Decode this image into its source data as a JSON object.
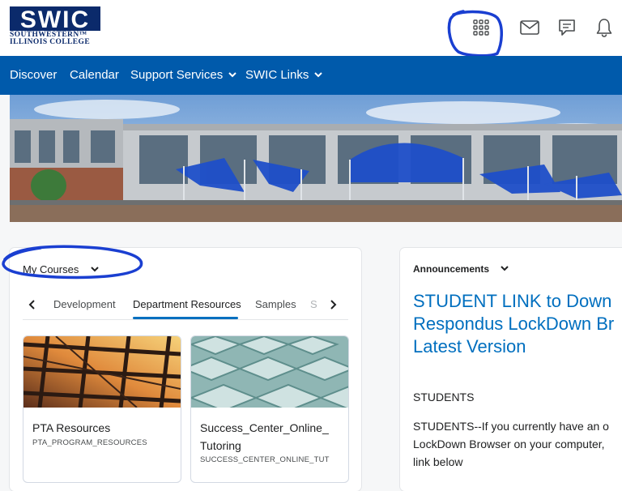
{
  "header": {
    "logo_abbrev": "SWIC",
    "logo_line1": "SOUTHWESTERN™",
    "logo_line2": "ILLINOIS COLLEGE",
    "icons": [
      "apps-grid-icon",
      "mail-icon",
      "chat-icon",
      "bell-icon"
    ]
  },
  "navbar": {
    "items": [
      {
        "label": "Discover"
      },
      {
        "label": "Calendar"
      },
      {
        "label": "Support Services"
      },
      {
        "label": "SWIC Links"
      }
    ]
  },
  "my_courses": {
    "title": "My Courses",
    "tabs": [
      {
        "label": "Development"
      },
      {
        "label": "Department Resources",
        "selected": true
      },
      {
        "label": "Samples"
      },
      {
        "label": "S"
      }
    ],
    "courses": [
      {
        "name": "PTA Resources",
        "code": "PTA_PROGRAM_RESOURCES"
      },
      {
        "name_line1": "Success_Center_Online_",
        "name_line2": "Tutoring",
        "code": "SUCCESS_CENTER_ONLINE_TUT"
      }
    ]
  },
  "announcements": {
    "title": "Announcements",
    "headline_lines": [
      "STUDENT LINK to Down",
      "Respondus LockDown Br",
      "Latest Version"
    ],
    "body_heading": "STUDENTS",
    "body_lines": [
      "STUDENTS--If you currently have an o",
      "LockDown Browser on your computer,",
      "link below"
    ]
  },
  "colors": {
    "brand_blue": "#005aab",
    "link_blue": "#006fbf",
    "annotation_blue": "#1a3fd1"
  }
}
